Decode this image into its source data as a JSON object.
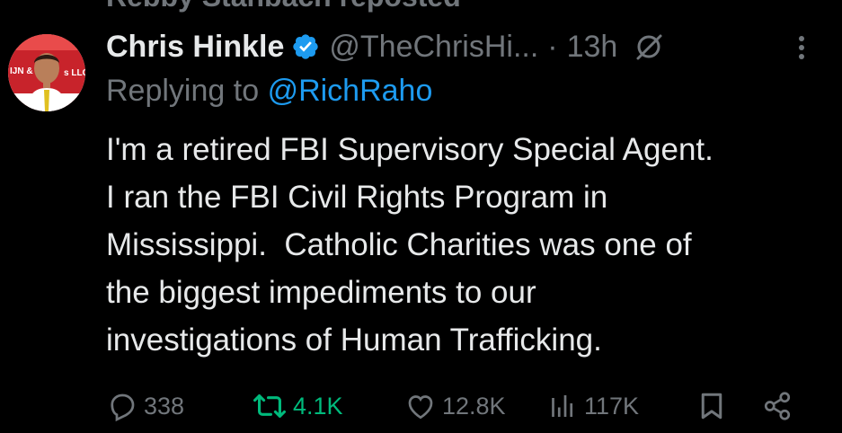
{
  "social_context": "Rebby Stanbach reposted",
  "author": {
    "display_name": "Chris Hinkle",
    "handle": "@TheChrisHi...",
    "separator": "·",
    "time": "13h"
  },
  "reply": {
    "prefix": "Replying to",
    "mention": "@RichRaho"
  },
  "body_lines": [
    "I'm a retired FBI Supervisory Special Agent.",
    "I ran the FBI Civil Rights Program in",
    "Mississippi.  Catholic Charities was one of",
    "the biggest impediments to our",
    "investigations of Human Trafficking."
  ],
  "avatar_banner_text": {
    "left": "IJN &",
    "right": "s LLC"
  },
  "actions": {
    "replies": "338",
    "reposts": "4.1K",
    "likes": "12.8K",
    "views": "117K"
  },
  "colors": {
    "background": "#000000",
    "text": "#e7e9ea",
    "muted": "#71767b",
    "link": "#1d9bf0",
    "repost_active": "#00ba7c"
  },
  "icons": [
    "verified-badge-icon",
    "grok-icon",
    "more-icon",
    "reply-icon",
    "repost-icon",
    "like-icon",
    "views-icon",
    "bookmark-icon",
    "share-icon"
  ]
}
